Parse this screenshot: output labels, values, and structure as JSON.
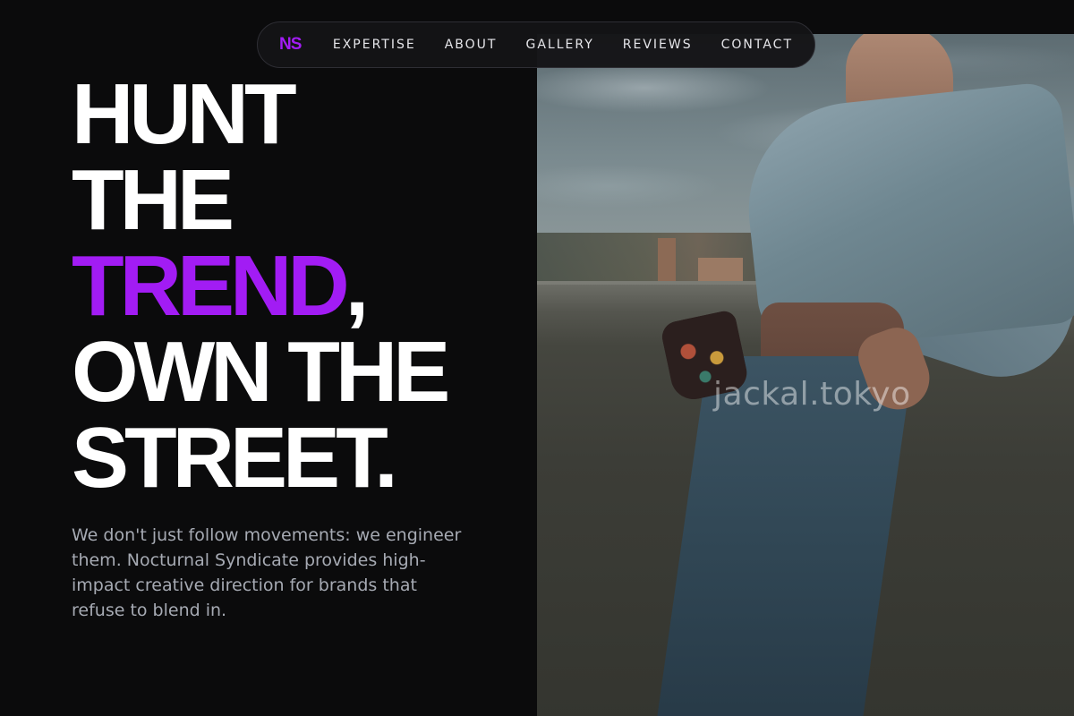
{
  "nav": {
    "logo": "NS",
    "links": [
      "EXPERTISE",
      "ABOUT",
      "GALLERY",
      "REVIEWS",
      "CONTACT"
    ]
  },
  "hero": {
    "headline": {
      "line1": "HUNT",
      "line2": "THE",
      "line3_accent": "TREND",
      "line3_rest": ",",
      "line4": "OWN THE",
      "line5": "STREET."
    },
    "intro": "We don't just follow movements: we engineer them. Nocturnal Syndicate provides high-impact creative direction for brands that refuse to blend in.",
    "photo_watermark": "jackal.tokyo"
  },
  "colors": {
    "background": "#0b0b0c",
    "accent": "#a21cf4",
    "text": "#ffffff",
    "muted_text": "#a6aab3"
  }
}
